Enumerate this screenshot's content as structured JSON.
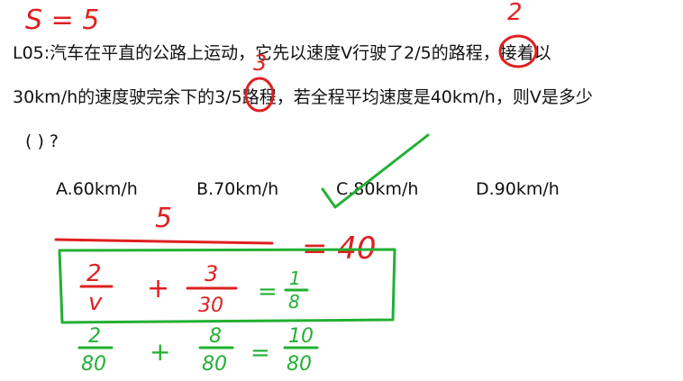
{
  "question": {
    "line1": "L05:汽车在平直的公路上运动，它先以速度V行驶了2/5的路程，接着以",
    "line2": "30km/h的速度驶完余下的3/5路程，若全程平均速度是40km/h，则V是多少",
    "line3": "( ) ?"
  },
  "options": {
    "a": "A.60km/h",
    "b": "B.70km/h",
    "c": "C.80km/h",
    "d": "D.90km/h"
  },
  "annotations": {
    "top_left": "S = 5",
    "above_first_fraction": "2",
    "above_second_fraction": "3",
    "numerator_5": "5",
    "eq_40": "= 40",
    "box_f1_num": "2",
    "box_f1_den": "v",
    "box_plus": "+",
    "box_f2_num": "3",
    "box_f2_den": "30",
    "box_eq": "=",
    "box_r_num": "1",
    "box_r_den": "8",
    "bot_f1_num": "2",
    "bot_f1_den": "80",
    "bot_plus": "+",
    "bot_f2_num": "8",
    "bot_f2_den": "80",
    "bot_eq": "=",
    "bot_r_num": "10",
    "bot_r_den": "80",
    "colors": {
      "red": "#e02020",
      "green": "#22b033",
      "text": "#111111"
    }
  }
}
